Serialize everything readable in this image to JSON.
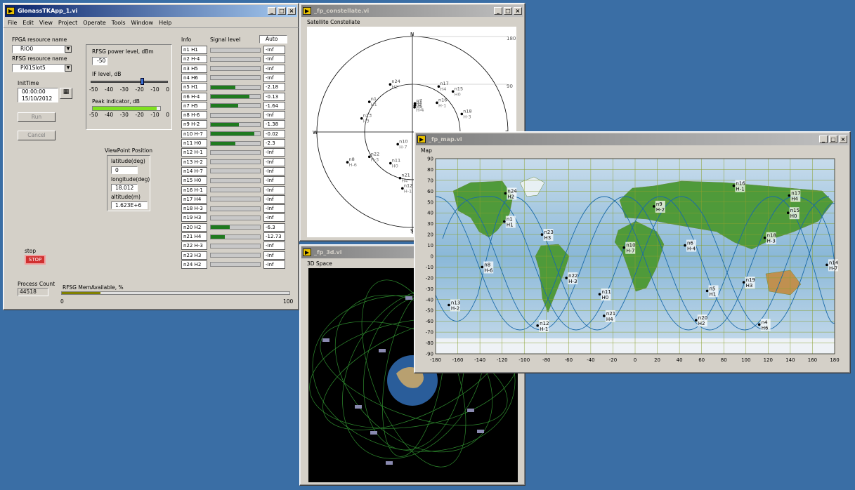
{
  "main": {
    "title": "GlonassTKApp_1.vi",
    "menu": [
      "File",
      "Edit",
      "View",
      "Project",
      "Operate",
      "Tools",
      "Window",
      "Help"
    ],
    "fpga_label": "FPGA resource name",
    "fpga_value": "RIO0",
    "rfsg_label": "RFSG resource name",
    "rfsg_value": "PXI1Slot5",
    "init_label": "InitTime",
    "init_time": "00:00:00",
    "init_date": "15/10/2012",
    "run": "Run",
    "cancel": "Cancel",
    "power_label": "RFSG power level, dBm",
    "power_value": "-50",
    "if_label": "IF level, dB",
    "scale": [
      "-50",
      "-40",
      "-30",
      "-20",
      "-10",
      "0"
    ],
    "peak_label": "Peak indicator, dB",
    "vp_label": "ViewPoint Position",
    "lat_label": "latitude(deg)",
    "lat_value": "0",
    "lon_label": "longitude(deg)",
    "lon_value": "18.012",
    "alt_label": "altitude(m)",
    "alt_value": "1.623E+6",
    "info_label": "Info",
    "signal_label": "Signal level",
    "auto": "Auto",
    "stop_label": "stop",
    "stop": "STOP",
    "pc_label": "Process Count",
    "pc_value": "44518",
    "mem_label": "RFSG MemAvailable, %",
    "mem_min": "0",
    "mem_max": "100",
    "mem_level": 0.17,
    "if_level": 0.66,
    "peak_level": 0.95
  },
  "sats": [
    {
      "name": "n1 H1",
      "value": "-Inf",
      "level": 0
    },
    {
      "name": "n2 H-4",
      "value": "-Inf",
      "level": 0
    },
    {
      "name": "n3 H5",
      "value": "-Inf",
      "level": 0
    },
    {
      "name": "n4 H6",
      "value": "-Inf",
      "level": 0
    },
    {
      "name": "n5 H1",
      "value": "-2.18",
      "level": 0.5
    },
    {
      "name": "n6 H-4",
      "value": "-0.13",
      "level": 0.78
    },
    {
      "name": "n7 H5",
      "value": "-1.64",
      "level": 0.55
    },
    {
      "name": "n8 H-6",
      "value": "-Inf",
      "level": 0
    },
    {
      "name": "n9 H-2",
      "value": "-1.38",
      "level": 0.57
    },
    {
      "name": "n10 H-7",
      "value": "-0.02",
      "level": 0.88
    },
    {
      "name": "n11 H0",
      "value": "-2.3",
      "level": 0.5
    },
    {
      "name": "n12 H-1",
      "value": "-Inf",
      "level": 0
    },
    {
      "name": "n13 H-2",
      "value": "-Inf",
      "level": 0
    },
    {
      "name": "n14 H-7",
      "value": "-Inf",
      "level": 0
    },
    {
      "name": "n15 H0",
      "value": "-Inf",
      "level": 0
    },
    {
      "name": "n16 H-1",
      "value": "-Inf",
      "level": 0
    },
    {
      "name": "n17 H4",
      "value": "-Inf",
      "level": 0
    },
    {
      "name": "n18 H-3",
      "value": "-Inf",
      "level": 0
    },
    {
      "name": "n19 H3",
      "value": "-Inf",
      "level": 0
    },
    {
      "name": "n20 H2",
      "value": "-6.3",
      "level": 0.38
    },
    {
      "name": "n21 H4",
      "value": "-12.73",
      "level": 0.28
    },
    {
      "name": "n22 H-3",
      "value": "-Inf",
      "level": 0
    },
    {
      "name": "n23 H3",
      "value": "-Inf",
      "level": 0
    },
    {
      "name": "n24 H2",
      "value": "-Inf",
      "level": 0
    }
  ],
  "constellate": {
    "title": "_fp_constellate.vi",
    "label": "Satellite Constellate",
    "dirs": {
      "n": "N",
      "w": "W",
      "e": "E",
      "s": "S"
    },
    "ring_labels": [
      "180",
      "90"
    ]
  },
  "space3d": {
    "title": "_fp_3d.vi",
    "label": "3D Space"
  },
  "map": {
    "title": "_fp_map.vi",
    "label": "Map",
    "yticks": [
      "90",
      "80",
      "70",
      "60",
      "50",
      "40",
      "30",
      "20",
      "10",
      "0",
      "-10",
      "-20",
      "-30",
      "-40",
      "-50",
      "-60",
      "-70",
      "-80",
      "-90"
    ],
    "xticks": [
      "-180",
      "-160",
      "-140",
      "-120",
      "-100",
      "-80",
      "-60",
      "-40",
      "-20",
      "0",
      "20",
      "40",
      "60",
      "80",
      "100",
      "120",
      "140",
      "160",
      "180"
    ],
    "points": [
      {
        "n": "n24",
        "h": "H2",
        "lon": -117,
        "lat": 58
      },
      {
        "n": "n1",
        "h": "H1",
        "lon": -118,
        "lat": 32
      },
      {
        "n": "n23",
        "h": "H3",
        "lon": -84,
        "lat": 20
      },
      {
        "n": "n8",
        "h": "H-6",
        "lon": -138,
        "lat": -10
      },
      {
        "n": "n22",
        "h": "H-3",
        "lon": -62,
        "lat": -20
      },
      {
        "n": "n11",
        "h": "H0",
        "lon": -32,
        "lat": -35
      },
      {
        "n": "n13",
        "h": "H-2",
        "lon": -168,
        "lat": -45
      },
      {
        "n": "n21",
        "h": "H4",
        "lon": -28,
        "lat": -55
      },
      {
        "n": "n12",
        "h": "H-1",
        "lon": -88,
        "lat": -64
      },
      {
        "n": "n10",
        "h": "H-7",
        "lon": -10,
        "lat": 8
      },
      {
        "n": "n9",
        "h": "H-2",
        "lon": 17,
        "lat": 46
      },
      {
        "n": "n6",
        "h": "H-4",
        "lon": 45,
        "lat": 10
      },
      {
        "n": "n5",
        "h": "H1",
        "lon": 65,
        "lat": -32
      },
      {
        "n": "n20",
        "h": "H2",
        "lon": 55,
        "lat": -59
      },
      {
        "n": "n19",
        "h": "H3",
        "lon": 98,
        "lat": -24
      },
      {
        "n": "n4",
        "h": "H6",
        "lon": 112,
        "lat": -63
      },
      {
        "n": "n16",
        "h": "H-1",
        "lon": 89,
        "lat": 65
      },
      {
        "n": "n17",
        "h": "H4",
        "lon": 139,
        "lat": 56
      },
      {
        "n": "n15",
        "h": "H0",
        "lon": 138,
        "lat": 40
      },
      {
        "n": "n18",
        "h": "H-3",
        "lon": 117,
        "lat": 17
      },
      {
        "n": "n14",
        "h": "H-7",
        "lon": 173,
        "lat": -8
      }
    ]
  },
  "polar_points": [
    {
      "n": "n1",
      "h": "H1",
      "az": -55,
      "r": 0.55
    },
    {
      "n": "n24",
      "h": "H2",
      "az": -25,
      "r": 0.55
    },
    {
      "n": "n23",
      "h": "H3",
      "az": -75,
      "r": 0.55
    },
    {
      "n": "n17",
      "h": "H4",
      "az": 30,
      "r": 0.55
    },
    {
      "n": "n15",
      "h": "H0",
      "az": 45,
      "r": 0.6
    },
    {
      "n": "n16",
      "h": "H-1",
      "az": 40,
      "r": 0.4
    },
    {
      "n": "n18",
      "h": "H-3",
      "az": 70,
      "r": 0.55
    },
    {
      "n": "n7",
      "h": "H5",
      "az": 5,
      "r": 0.3
    },
    {
      "n": "n3",
      "h": "H5",
      "az": 5,
      "r": 0.28
    },
    {
      "n": "n2",
      "h": "H-4",
      "az": 5,
      "r": 0.26
    },
    {
      "n": "n10",
      "h": "H-7",
      "az": -130,
      "r": 0.2
    },
    {
      "n": "n6",
      "h": "H-4",
      "az": 120,
      "r": 0.2
    },
    {
      "n": "n22",
      "h": "H-3",
      "az": -120,
      "r": 0.52
    },
    {
      "n": "n11",
      "h": "H0",
      "az": -145,
      "r": 0.4
    },
    {
      "n": "n8",
      "h": "H-6",
      "az": -115,
      "r": 0.75
    },
    {
      "n": "n21",
      "h": "H4",
      "az": -165,
      "r": 0.5
    },
    {
      "n": "n12",
      "h": "H-1",
      "az": -170,
      "r": 0.6
    }
  ]
}
